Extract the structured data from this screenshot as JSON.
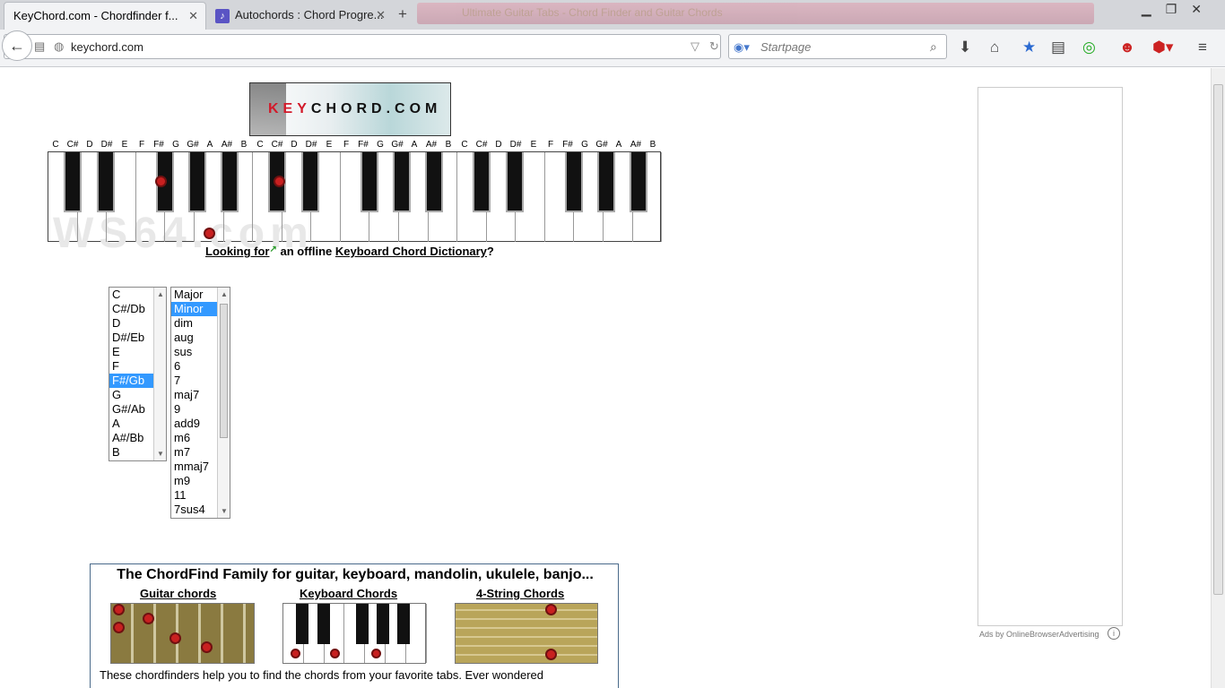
{
  "browser": {
    "tabs": [
      {
        "label": "KeyChord.com - Chordfinder f...",
        "active": true
      },
      {
        "label": "Autochords : Chord Progre...",
        "active": false
      }
    ],
    "blurred_tab": "Ultimate Guitar Tabs - Chord Finder and Guitar Chords",
    "url": "keychord.com",
    "search_placeholder": "Startpage"
  },
  "page": {
    "logo": {
      "key": "KEY",
      "rest": "CHORD.COM"
    },
    "note_labels": [
      "C",
      "C#",
      "D",
      "D#",
      "E",
      "F",
      "F#",
      "G",
      "G#",
      "A",
      "A#",
      "B",
      "C",
      "C#",
      "D",
      "D#",
      "E",
      "F",
      "F#",
      "G",
      "G#",
      "A",
      "A#",
      "B",
      "C",
      "C#",
      "D",
      "D#",
      "E",
      "F",
      "F#",
      "G",
      "G#",
      "A",
      "A#",
      "B"
    ],
    "watermark": "WS64.com",
    "looking_for": {
      "link1": "Looking for",
      "middle": " an offline ",
      "link2": "Keyboard Chord Dictionary",
      "end": "?"
    },
    "roots": [
      "C",
      "C#/Db",
      "D",
      "D#/Eb",
      "E",
      "F",
      "F#/Gb",
      "G",
      "G#/Ab",
      "A",
      "A#/Bb",
      "B"
    ],
    "root_selected": "F#/Gb",
    "chord_types": [
      "Major",
      "Minor",
      "dim",
      "aug",
      "sus",
      "6",
      "7",
      "maj7",
      "9",
      "add9",
      "m6",
      "m7",
      "mmaj7",
      "m9",
      "11",
      "7sus4"
    ],
    "type_selected": "Minor",
    "family": {
      "title": "The ChordFind Family for guitar, keyboard, mandolin, ukulele, banjo...",
      "guitar": "Guitar chords",
      "keyboard": "Keyboard Chords",
      "string4": "4-String Chords",
      "desc": "These chordfinders help you to find the chords from your favorite tabs. Ever wondered"
    },
    "ad_footer": "Ads by OnlineBrowserAdvertising",
    "ad_options": "Ad Options"
  },
  "colors": {
    "selection": "#3399ff",
    "dot": "#c82020"
  }
}
